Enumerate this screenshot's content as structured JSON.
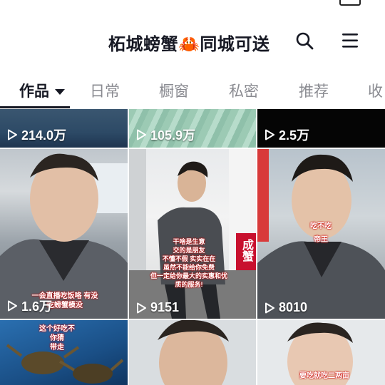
{
  "header": {
    "title": "柘城螃蟹🦀同城可送",
    "search_icon": "search-icon",
    "menu_icon": "hamburger-menu-icon"
  },
  "tabs": [
    {
      "label": "作品",
      "active": true
    },
    {
      "label": "日常",
      "active": false
    },
    {
      "label": "橱窗",
      "active": false
    },
    {
      "label": "私密",
      "active": false
    },
    {
      "label": "推荐",
      "active": false
    },
    {
      "label": "收",
      "active": false
    }
  ],
  "videos": [
    {
      "plays": "214.0万"
    },
    {
      "plays": "105.9万"
    },
    {
      "plays": "2.5万"
    },
    {
      "plays": "1.6万",
      "caption": "一会直播吃饭咯 有没吃螃蟹模没"
    },
    {
      "plays": "9151",
      "caption_lines": [
        "干啥是生意",
        "交的是朋友",
        "不懂不假 实实在在",
        "虽然不能给你免费",
        "但一定给你最大的实惠和优",
        "质的服务!"
      ],
      "van_text": "成蟹"
    },
    {
      "plays": "8010",
      "caption_lines": [
        "吃不吃",
        "帝王"
      ]
    },
    {
      "plays": "",
      "caption_lines": [
        "这个好吃不",
        "你猜",
        "带走"
      ]
    },
    {
      "plays": ""
    },
    {
      "plays": "",
      "caption": "要吃就吃二两亩"
    }
  ],
  "colors": {
    "text": "#161823",
    "inactive": "#8a8b91",
    "accent": "#161823"
  }
}
